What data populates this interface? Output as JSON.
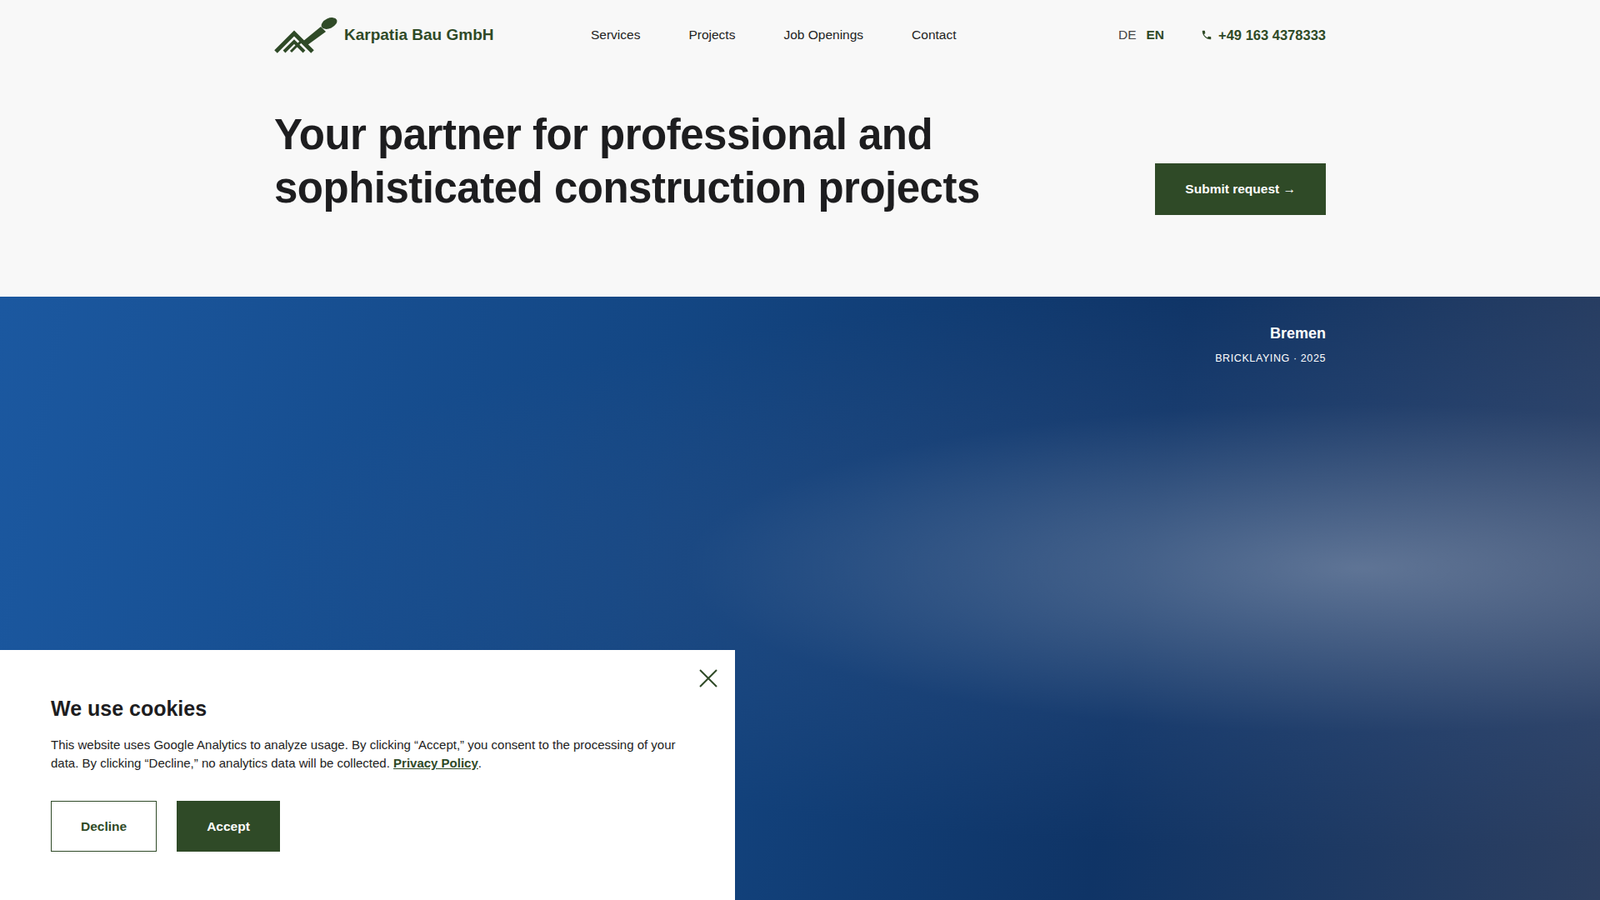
{
  "header": {
    "logo_text": "Karpatia Bau GmbH",
    "nav": [
      {
        "label": "Services"
      },
      {
        "label": "Projects"
      },
      {
        "label": "Job Openings"
      },
      {
        "label": "Contact"
      }
    ],
    "languages": [
      {
        "label": "DE",
        "selected": false
      },
      {
        "label": "EN",
        "selected": true
      }
    ],
    "phone": "+49 163 4378333"
  },
  "hero": {
    "heading_lines": [
      "Your partner for professional and",
      "sophisticated construction projects"
    ],
    "cta": "Submit request →",
    "project": {
      "city": "Bremen",
      "meta": "BRICKLAYING · 2025"
    }
  },
  "cookie_banner": {
    "title": "We use cookies",
    "text_before": "This website uses Google Analytics to analyze usage. By clicking “Accept,” you consent to the processing of your data. By clicking “Decline,” no analytics data will be collected.",
    "link": "Privacy Policy",
    "text_after": ".",
    "buttons": [
      {
        "label": "Decline",
        "kind": "outline"
      },
      {
        "label": "Accept",
        "kind": "filled"
      }
    ]
  }
}
